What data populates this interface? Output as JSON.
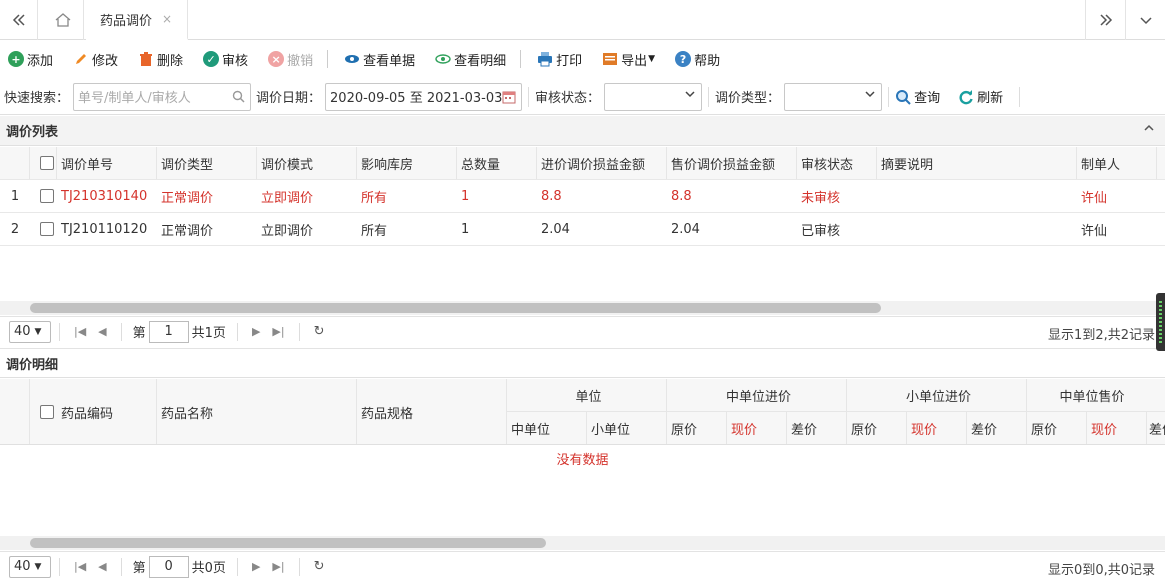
{
  "tabs": {
    "back_icon": "double-chevron-left-icon",
    "home_icon": "home-icon",
    "active_tab": "药品调价",
    "close_glyph": "×",
    "forward_icon": "double-chevron-right-icon",
    "menu_icon": "chevron-down-icon"
  },
  "toolbar": {
    "add": "添加",
    "edit": "修改",
    "delete": "删除",
    "audit": "审核",
    "revoke": "撤销",
    "view_doc": "查看单据",
    "view_detail": "查看明细",
    "print": "打印",
    "export": "导出",
    "help": "帮助"
  },
  "search": {
    "quick_label": "快速搜索：",
    "quick_placeholder": "单号/制单人/审核人",
    "date_label": "调价日期：",
    "date_value": "2020-09-05 至 2021-03-03",
    "audit_label": "审核状态：",
    "audit_value": "",
    "type_label": "调价类型：",
    "type_value": "",
    "query": "查询",
    "refresh": "刷新"
  },
  "list_panel": {
    "title": "调价列表",
    "columns": [
      "调价单号",
      "调价类型",
      "调价模式",
      "影响库房",
      "总数量",
      "进价调价损益金额",
      "售价调价损益金额",
      "审核状态",
      "摘要说明",
      "制单人"
    ],
    "rows": [
      {
        "num": "1",
        "highlight": true,
        "cells": [
          "TJ210310140",
          "正常调价",
          "立即调价",
          "所有",
          "1",
          "8.8",
          "8.8",
          "未审核",
          "",
          "许仙"
        ]
      },
      {
        "num": "2",
        "highlight": false,
        "cells": [
          "TJ210110120",
          "正常调价",
          "立即调价",
          "所有",
          "1",
          "2.04",
          "2.04",
          "已审核",
          "",
          "许仙"
        ]
      }
    ],
    "pager": {
      "page_size": "40",
      "page_prefix": "第",
      "page_value": "1",
      "page_total": "共1页",
      "info": "显示1到2,共2记录"
    }
  },
  "detail_panel": {
    "title": "调价明细",
    "col_code": "药品编码",
    "col_name": "药品名称",
    "col_spec": "药品规格",
    "group_unit": "单位",
    "group_mid_buy": "中单位进价",
    "group_small_buy": "小单位进价",
    "group_mid_sell": "中单位售价",
    "sub_mid_unit": "中单位",
    "sub_small_unit": "小单位",
    "sub_orig": "原价",
    "sub_now": "现价",
    "sub_diff": "差价",
    "no_data": "没有数据",
    "pager": {
      "page_size": "40",
      "page_prefix": "第",
      "page_value": "0",
      "page_total": "共0页",
      "info": "显示0到0,共0记录"
    }
  },
  "colors": {
    "highlight_red": "#d4332c",
    "accent_green": "#2fa05a",
    "accent_blue": "#3b82c4"
  }
}
